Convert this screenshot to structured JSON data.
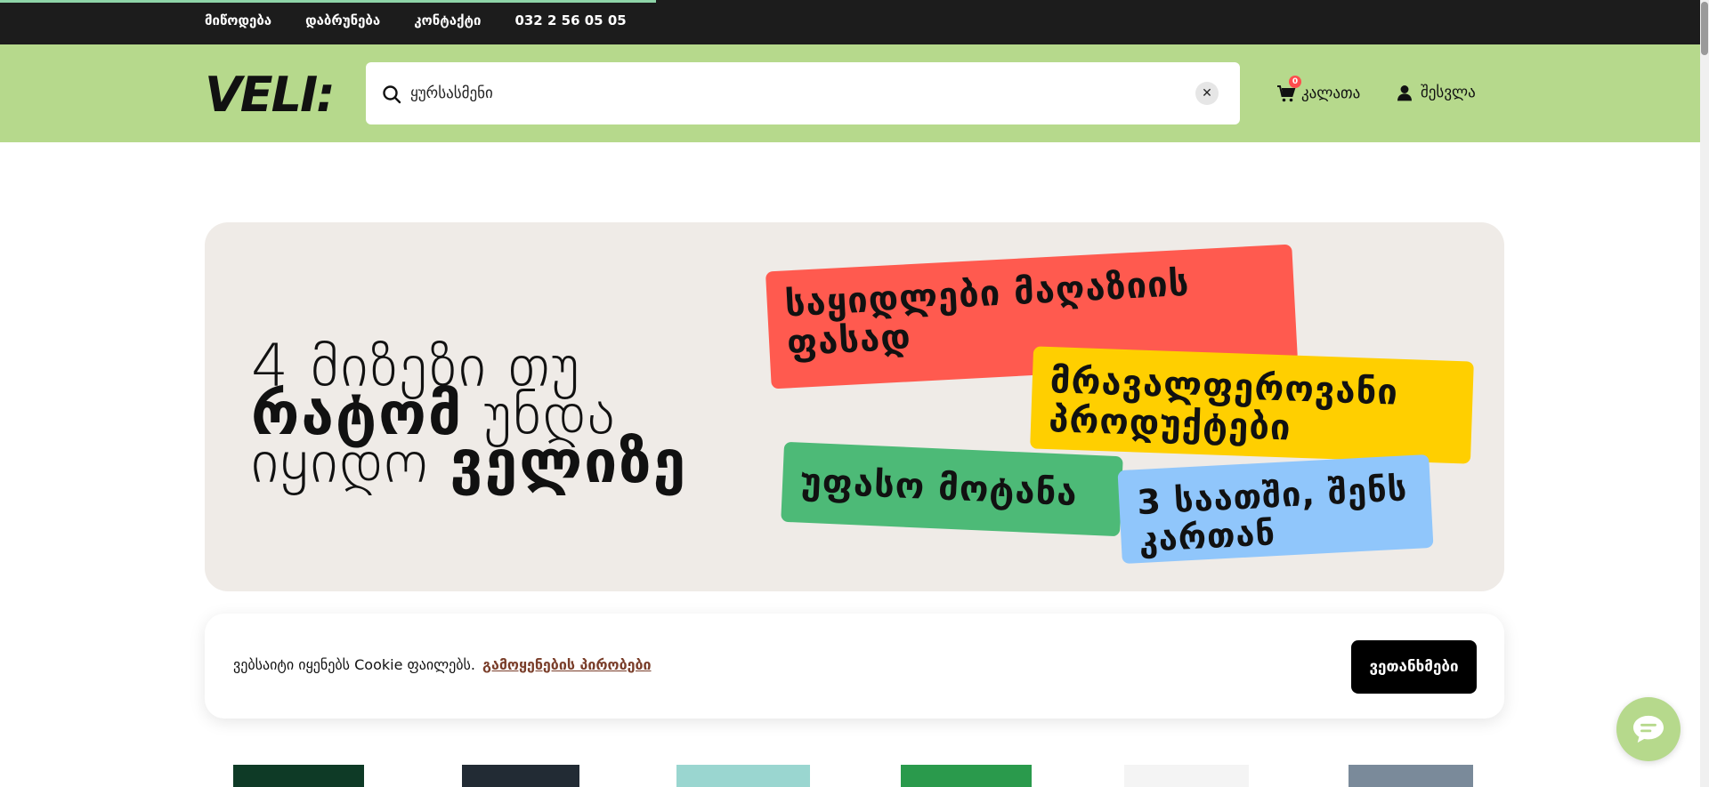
{
  "topnav": [
    {
      "label": "მიწოდება"
    },
    {
      "label": "დაბრუნება"
    },
    {
      "label": "კონტაქტი"
    },
    {
      "label": "032 2 56 05 05"
    }
  ],
  "header": {
    "logo_text": "VELI:",
    "search": {
      "value": "ყურსასმენი",
      "placeholder": ""
    },
    "cart": {
      "label": "კალათა",
      "count": "0"
    },
    "login": {
      "label": "შესვლა"
    }
  },
  "banner": {
    "headline": {
      "line1": "4 მიზეზი თუ",
      "line2_bold": "რატომ",
      "line2_thin": " უნდა",
      "line3_thin": "იყიდო ",
      "line3_bold": "ველიზე"
    },
    "tags": {
      "red": "საყიდლები მაღაზიის ფასად",
      "yellow": "მრავალფეროვანი პროდუქტები",
      "green": "უფასო მოტანა",
      "blue": "3 საათში, შენს კართან"
    },
    "colors": {
      "red": "#ff5a4f",
      "yellow": "#ffcf00",
      "green": "#4dba77",
      "blue": "#90c6fb"
    }
  },
  "cookie": {
    "message": "ვებსაიტი იყენებს Cookie ფაილებს.",
    "link": "გამოყენების პირობები",
    "button": "ვეთანხმები"
  },
  "colors": {
    "accent": "#b6d98c",
    "topbar": "#1c1c1c"
  }
}
